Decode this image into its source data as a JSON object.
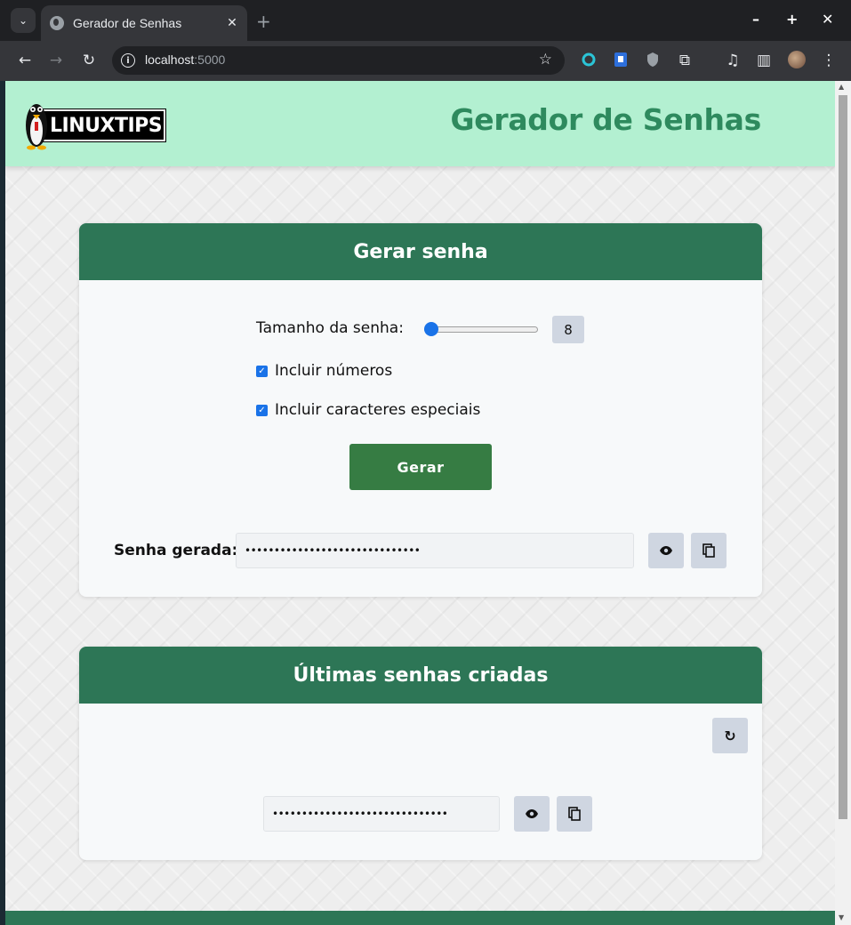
{
  "browser": {
    "tab_title": "Gerador de Senhas",
    "url_host": "localhost",
    "url_port": ":5000"
  },
  "header": {
    "logo_text": "LINUXTIPS",
    "title": "Gerador de Senhas"
  },
  "generator": {
    "heading": "Gerar senha",
    "length_label": "Tamanho da senha:",
    "length_value": "8",
    "length_fraction": 0.0,
    "include_numbers_label": "Incluir números",
    "include_numbers_checked": true,
    "include_special_label": "Incluir caracteres especiais",
    "include_special_checked": true,
    "generate_button": "Gerar",
    "result_label": "Senha gerada:",
    "result_value": "••••••••••••••••••••••••••••••"
  },
  "history": {
    "heading": "Últimas senhas criadas",
    "items": [
      "••••••••••••••••••••••••••••••"
    ]
  },
  "colors": {
    "header_bg": "#b3f0d1",
    "title_green": "#2e8a5e",
    "card_head": "#2d7656",
    "button_green": "#367c43",
    "accent_blue": "#1a73e8"
  }
}
